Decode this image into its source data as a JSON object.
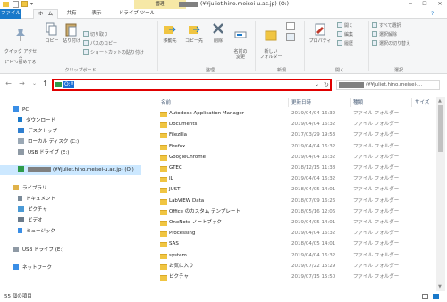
{
  "window": {
    "title_path": "(¥¥juliet.hino.meisei-u.ac.jp) (O:)",
    "context_tab": "管理",
    "minimize": "─",
    "maximize": "☐",
    "close": "✕"
  },
  "tabs": [
    {
      "label": "ファイル"
    },
    {
      "label": "ホーム"
    },
    {
      "label": "共有"
    },
    {
      "label": "表示"
    },
    {
      "label": "ドライブ ツール"
    }
  ],
  "ribbon": {
    "clipboard": {
      "pin_label": "クイック アクセス\nにピン留めする",
      "copy_label": "コピー",
      "paste_label": "貼り付け",
      "cut_label": "切り取り",
      "copy_path_label": "パスのコピー",
      "paste_shortcut_label": "ショートカットの貼り付け",
      "group_label": "クリップボード"
    },
    "organize": {
      "move_label": "移動先",
      "copyto_label": "コピー先",
      "delete_label": "削除",
      "rename_label": "名前の\n変更",
      "group_label": "整理"
    },
    "new": {
      "newfolder_label": "新しい\nフォルダー",
      "group_label": "新規"
    },
    "open": {
      "properties_label": "プロパティ",
      "open_label": "開く",
      "edit_label": "編集",
      "history_label": "履歴",
      "group_label": "開く"
    },
    "select": {
      "select_all_label": "すべて選択",
      "select_none_label": "選択解除",
      "invert_label": "選択の切り替え",
      "group_label": "選択"
    }
  },
  "address": {
    "back": "←",
    "forward": "→",
    "up_list": "⌄",
    "up": "↑",
    "path_text": "O:¥",
    "dropdown": "⌄",
    "refresh": "↻",
    "search_text": "(¥¥juliet.hino.meisei-..."
  },
  "nav": {
    "pc": "PC",
    "downloads": "ダウンロード",
    "desktop": "デスクトップ",
    "local_disk": "ローカル ディスク (C:)",
    "usb_e1": "USB ドライブ (E:)",
    "network_drive": "(¥¥juliet.hino.meisei-u.ac.jp) (O:)",
    "library": "ライブラリ",
    "documents": "ドキュメント",
    "pictures": "ピクチャ",
    "videos": "ビデオ",
    "music": "ミュージック",
    "usb_e2": "USB ドライブ (E:)",
    "network": "ネットワーク"
  },
  "list": {
    "col_name": "名前",
    "col_date": "更新日時",
    "col_type": "種類",
    "col_size": "サイズ",
    "rows": [
      {
        "name": "Autodesk Application Manager",
        "date": "2019/04/04 16:32",
        "type": "ファイル フォルダー"
      },
      {
        "name": "Documents",
        "date": "2019/04/04 16:32",
        "type": "ファイル フォルダー"
      },
      {
        "name": "Filezilla",
        "date": "2017/03/29 19:53",
        "type": "ファイル フォルダー"
      },
      {
        "name": "Firefox",
        "date": "2019/04/04 16:32",
        "type": "ファイル フォルダー"
      },
      {
        "name": "GoogleChrome",
        "date": "2019/04/04 16:32",
        "type": "ファイル フォルダー"
      },
      {
        "name": "GTEC",
        "date": "2018/12/15 11:38",
        "type": "ファイル フォルダー"
      },
      {
        "name": "IL",
        "date": "2019/04/04 16:32",
        "type": "ファイル フォルダー"
      },
      {
        "name": "JUST",
        "date": "2018/04/05 14:01",
        "type": "ファイル フォルダー"
      },
      {
        "name": "LabVIEW Data",
        "date": "2018/07/09 16:26",
        "type": "ファイル フォルダー"
      },
      {
        "name": "Office のカスタム テンプレート",
        "date": "2018/05/16 12:06",
        "type": "ファイル フォルダー"
      },
      {
        "name": "OneNote ノートブック",
        "date": "2019/04/05 14:01",
        "type": "ファイル フォルダー"
      },
      {
        "name": "Processing",
        "date": "2019/04/04 16:32",
        "type": "ファイル フォルダー"
      },
      {
        "name": "SAS",
        "date": "2018/04/05 14:01",
        "type": "ファイル フォルダー"
      },
      {
        "name": "system",
        "date": "2019/04/04 16:32",
        "type": "ファイル フォルダー"
      },
      {
        "name": "お気に入り",
        "date": "2019/07/22 15:29",
        "type": "ファイル フォルダー"
      },
      {
        "name": "ピクチャ",
        "date": "2019/07/15 15:50",
        "type": "ファイル フォルダー"
      }
    ]
  },
  "status": {
    "item_count": "55 個の項目"
  },
  "colors": {
    "accent": "#1979ca",
    "highlight_border": "#e00000",
    "selection": "#cce8ff",
    "folder": "#f0c542",
    "context_tab_bg": "#f6e8a6"
  }
}
